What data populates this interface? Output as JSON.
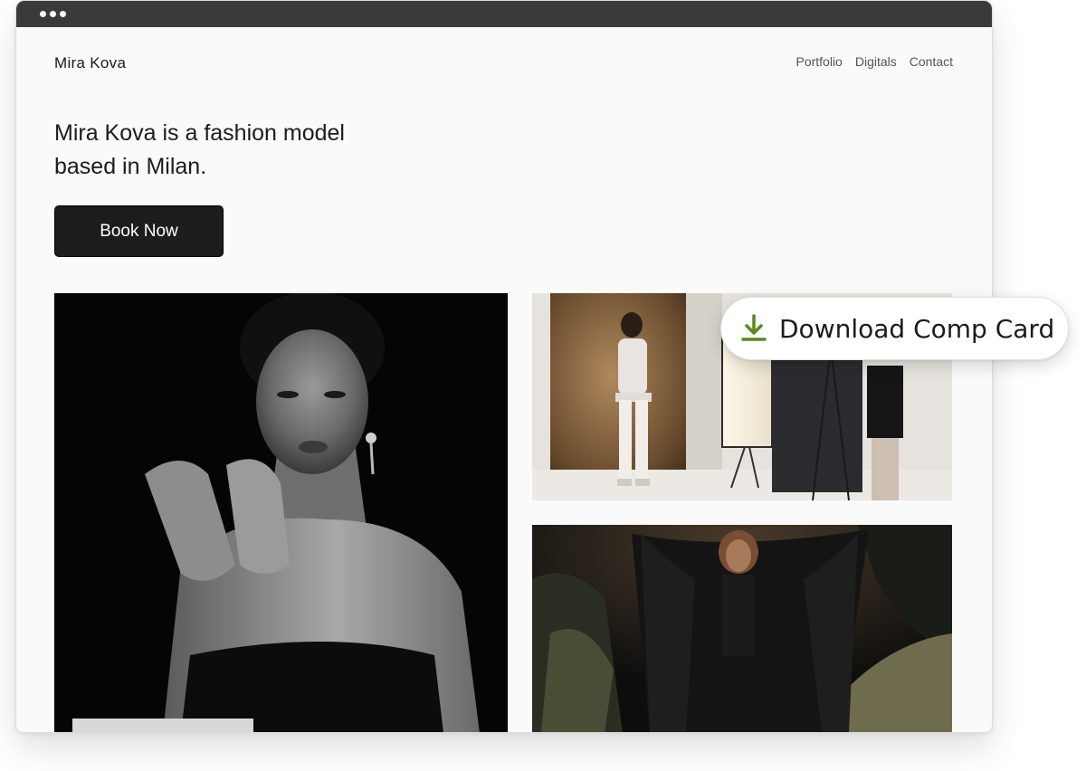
{
  "site": {
    "brand": "Mira Kova",
    "nav": [
      "Portfolio",
      "Digitals",
      "Contact"
    ]
  },
  "hero": {
    "headline": "Mira Kova is a fashion model based in Milan.",
    "cta_label": "Book Now"
  },
  "overlay": {
    "download_label": "Download Comp Card",
    "icon": "download-icon",
    "icon_color": "#5a8a22"
  },
  "gallery": {
    "photos": [
      "portrait-photo",
      "studio-photo",
      "cave-photo"
    ]
  },
  "theme": {
    "titlebar": "#3a3a3a",
    "button_bg": "#1d1d1d",
    "page_bg": "#fafafa"
  }
}
